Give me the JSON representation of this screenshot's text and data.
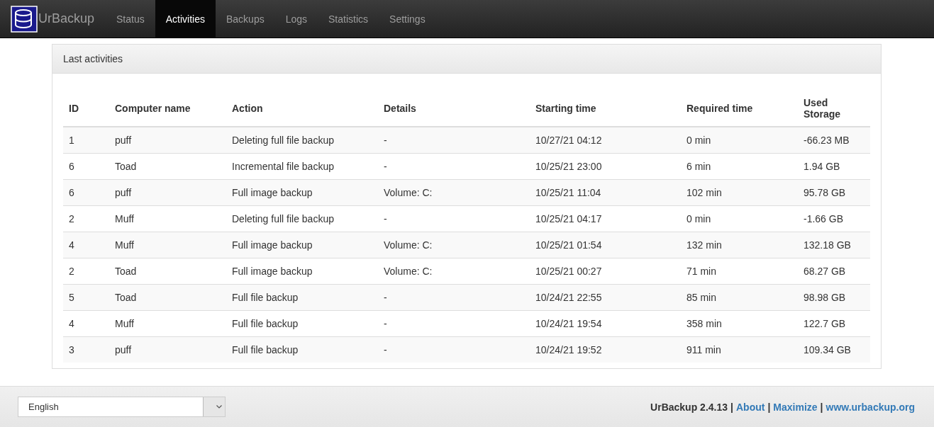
{
  "navbar": {
    "brand": "UrBackup",
    "items": [
      {
        "label": "Status",
        "selected": false
      },
      {
        "label": "Activities",
        "selected": true
      },
      {
        "label": "Backups",
        "selected": false
      },
      {
        "label": "Logs",
        "selected": false
      },
      {
        "label": "Statistics",
        "selected": false
      },
      {
        "label": "Settings",
        "selected": false
      }
    ]
  },
  "panel": {
    "title": "Last activities",
    "table": {
      "columns": [
        "ID",
        "Computer name",
        "Action",
        "Details",
        "Starting time",
        "Required time",
        "Used Storage"
      ],
      "rows": [
        [
          "1",
          "puff",
          "Deleting full file backup",
          "-",
          "10/27/21 04:12",
          "0 min",
          "-66.23 MB"
        ],
        [
          "6",
          "Toad",
          "Incremental file backup",
          "-",
          "10/25/21 23:00",
          "6 min",
          "1.94 GB"
        ],
        [
          "6",
          "puff",
          "Full image backup",
          "Volume: C:",
          "10/25/21 11:04",
          "102 min",
          "95.78 GB"
        ],
        [
          "2",
          "Muff",
          "Deleting full file backup",
          "-",
          "10/25/21 04:17",
          "0 min",
          "-1.66 GB"
        ],
        [
          "4",
          "Muff",
          "Full image backup",
          "Volume: C:",
          "10/25/21 01:54",
          "132 min",
          "132.18 GB"
        ],
        [
          "2",
          "Toad",
          "Full image backup",
          "Volume: C:",
          "10/25/21 00:27",
          "71 min",
          "68.27 GB"
        ],
        [
          "5",
          "Toad",
          "Full file backup",
          "-",
          "10/24/21 22:55",
          "85 min",
          "98.98 GB"
        ],
        [
          "4",
          "Muff",
          "Full file backup",
          "-",
          "10/24/21 19:54",
          "358 min",
          "122.7 GB"
        ],
        [
          "3",
          "puff",
          "Full file backup",
          "-",
          "10/24/21 19:52",
          "911 min",
          "109.34 GB"
        ]
      ]
    }
  },
  "footer": {
    "language": "English",
    "version": "UrBackup 2.4.13",
    "separator": "|",
    "links": [
      "About",
      "Maximize",
      "www.urbackup.org"
    ]
  }
}
